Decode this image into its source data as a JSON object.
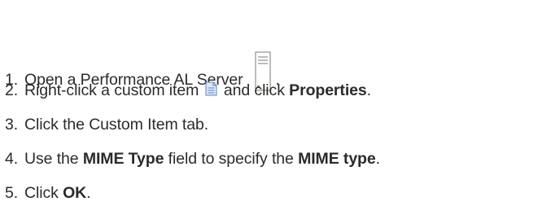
{
  "steps": [
    {
      "number": "1.",
      "text": "Open a Performance AL Server",
      "trailing": ".",
      "icon": "server-icon"
    },
    {
      "number": "2.",
      "text_before": "Right-click a custom item",
      "icon": "custom-item-document-icon",
      "text_after": "and click",
      "bold": "Properties",
      "trailing": "."
    },
    {
      "number": "3.",
      "text": "Click the Custom Item tab."
    },
    {
      "number": "4.",
      "text_before": "Use the",
      "bold1": "MIME Type",
      "text_middle": "field to specify the",
      "bold2": "MIME type",
      "trailing": "."
    },
    {
      "number": "5.",
      "text_before": "Click",
      "bold": "OK",
      "trailing": "."
    }
  ],
  "colors": {
    "text": "#2b2b2b",
    "icon_outline": "#7a7a7a",
    "server_led": "#3aa34a",
    "doc_fill": "#dfe8f5",
    "doc_lines": "#5b83c7"
  }
}
